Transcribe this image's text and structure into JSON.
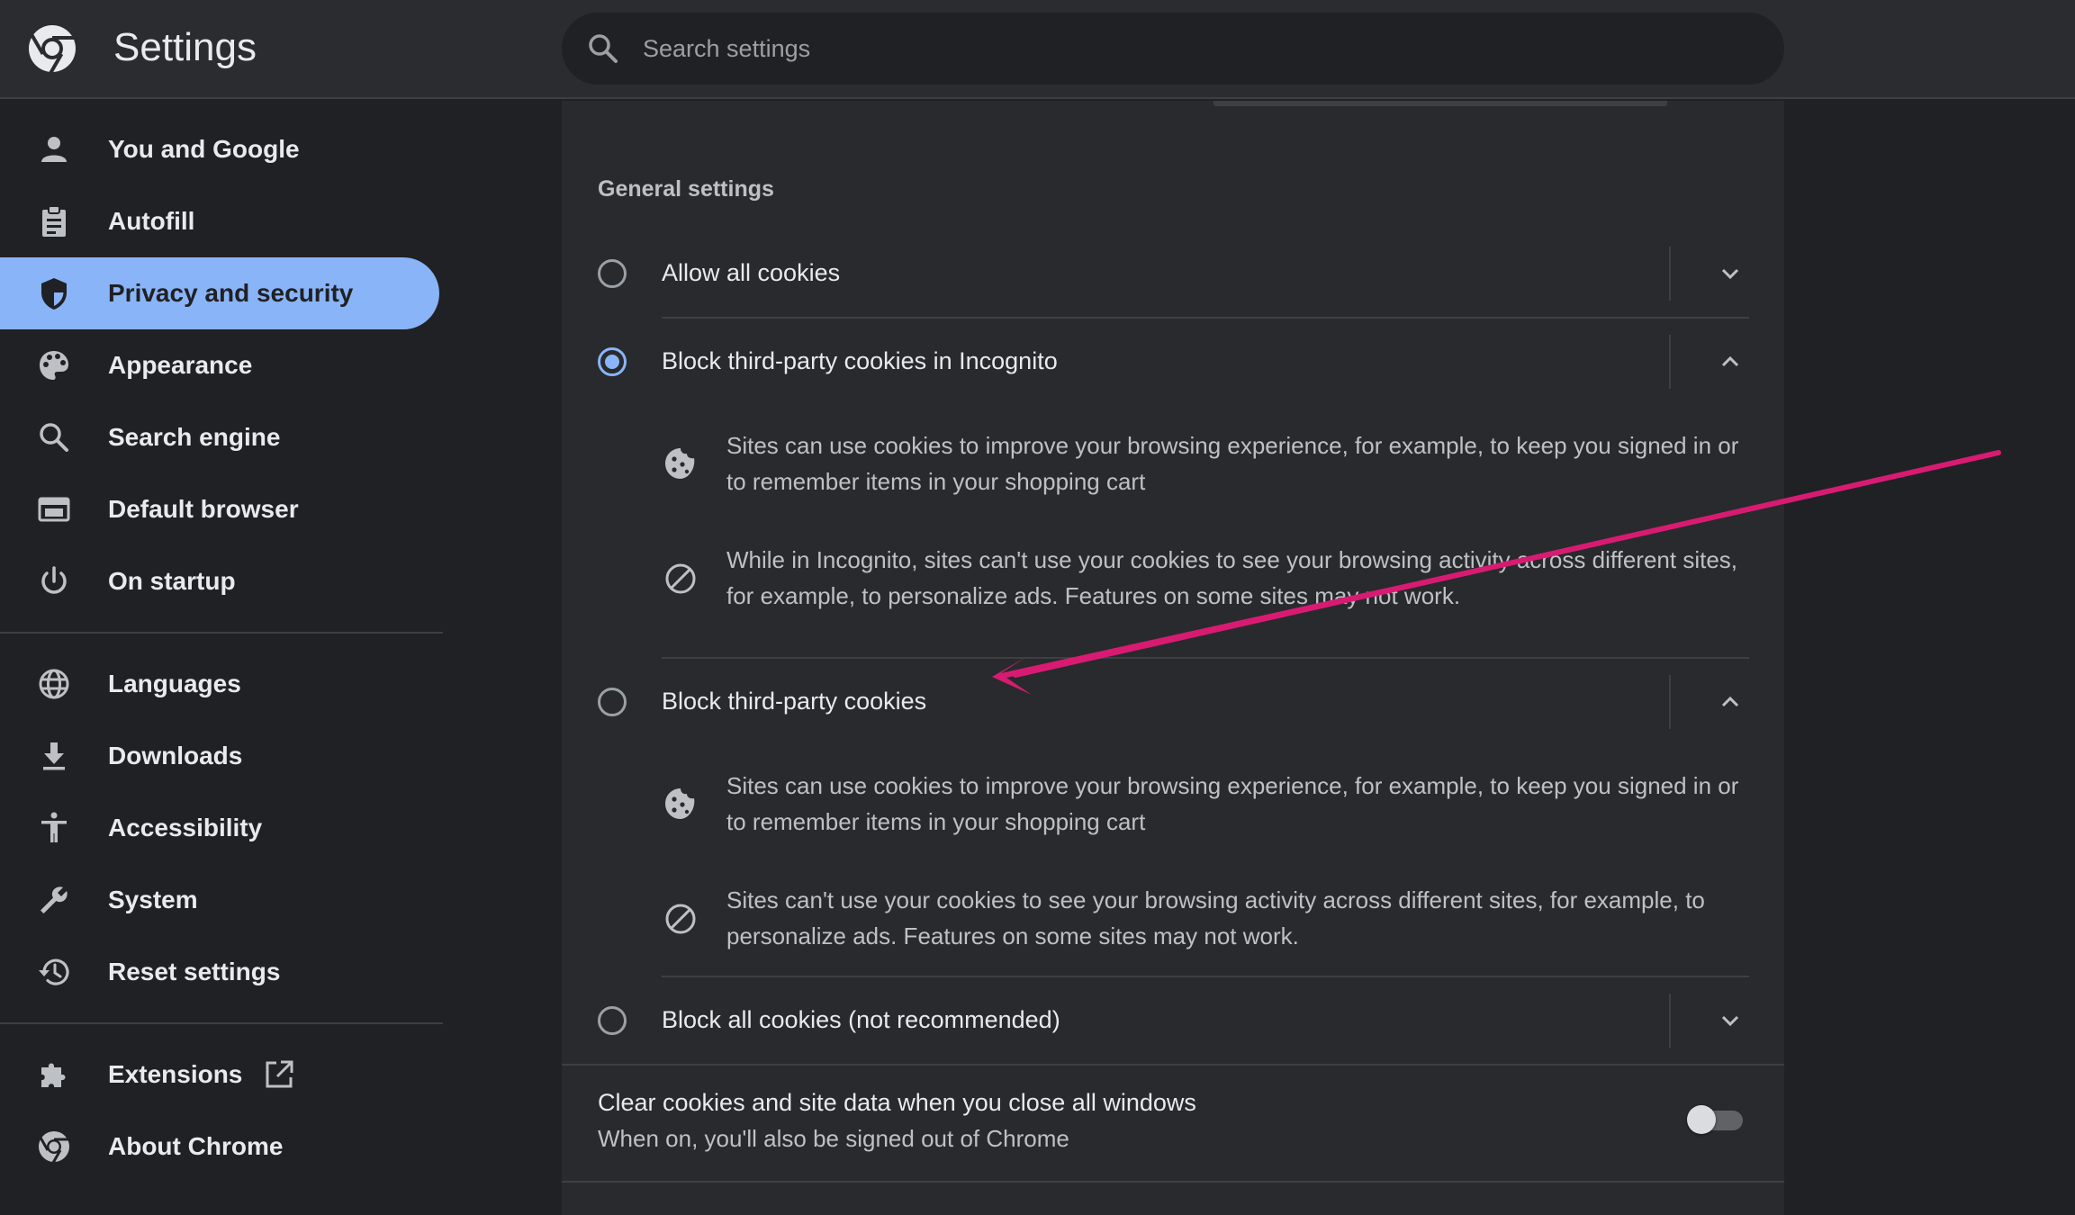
{
  "header": {
    "title": "Settings",
    "search": {
      "placeholder": "Search settings",
      "value": ""
    }
  },
  "sidebar": {
    "items": [
      {
        "label": "You and Google",
        "icon": "person-icon"
      },
      {
        "label": "Autofill",
        "icon": "clipboard-icon"
      },
      {
        "label": "Privacy and security",
        "icon": "shield-icon",
        "active": true
      },
      {
        "label": "Appearance",
        "icon": "palette-icon"
      },
      {
        "label": "Search engine",
        "icon": "search-icon"
      },
      {
        "label": "Default browser",
        "icon": "browser-window-icon"
      },
      {
        "label": "On startup",
        "icon": "power-icon"
      },
      {
        "label": "Languages",
        "icon": "globe-icon"
      },
      {
        "label": "Downloads",
        "icon": "download-icon"
      },
      {
        "label": "Accessibility",
        "icon": "accessibility-icon"
      },
      {
        "label": "System",
        "icon": "wrench-icon"
      },
      {
        "label": "Reset settings",
        "icon": "history-icon"
      },
      {
        "label": "Extensions",
        "icon": "puzzle-icon"
      },
      {
        "label": "About Chrome",
        "icon": "chrome-icon"
      }
    ]
  },
  "main": {
    "section_title": "General settings",
    "options": [
      {
        "label": "Allow all cookies",
        "checked": false,
        "expanded": false
      },
      {
        "label": "Block third-party cookies in Incognito",
        "checked": true,
        "expanded": true,
        "details": [
          "Sites can use cookies to improve your browsing experience, for example, to keep you signed in or to remember items in your shopping cart",
          "While in Incognito, sites can't use your cookies to see your browsing activity across different sites, for example, to personalize ads. Features on some sites may not work."
        ]
      },
      {
        "label": "Block third-party cookies",
        "checked": false,
        "expanded": true,
        "details": [
          "Sites can use cookies to improve your browsing experience, for example, to keep you signed in or to remember items in your shopping cart",
          "Sites can't use your cookies to see your browsing activity across different sites, for example, to personalize ads. Features on some sites may not work."
        ]
      },
      {
        "label": "Block all cookies (not recommended)",
        "checked": false,
        "expanded": false
      }
    ],
    "clear_on_exit": {
      "title": "Clear cookies and site data when you close all windows",
      "subtitle": "When on, you'll also be signed out of Chrome",
      "enabled": false
    }
  },
  "colors": {
    "background": "#202124",
    "card": "#292a2d",
    "accent": "#8ab4f8",
    "annotation_arrow": "#d81b72"
  }
}
